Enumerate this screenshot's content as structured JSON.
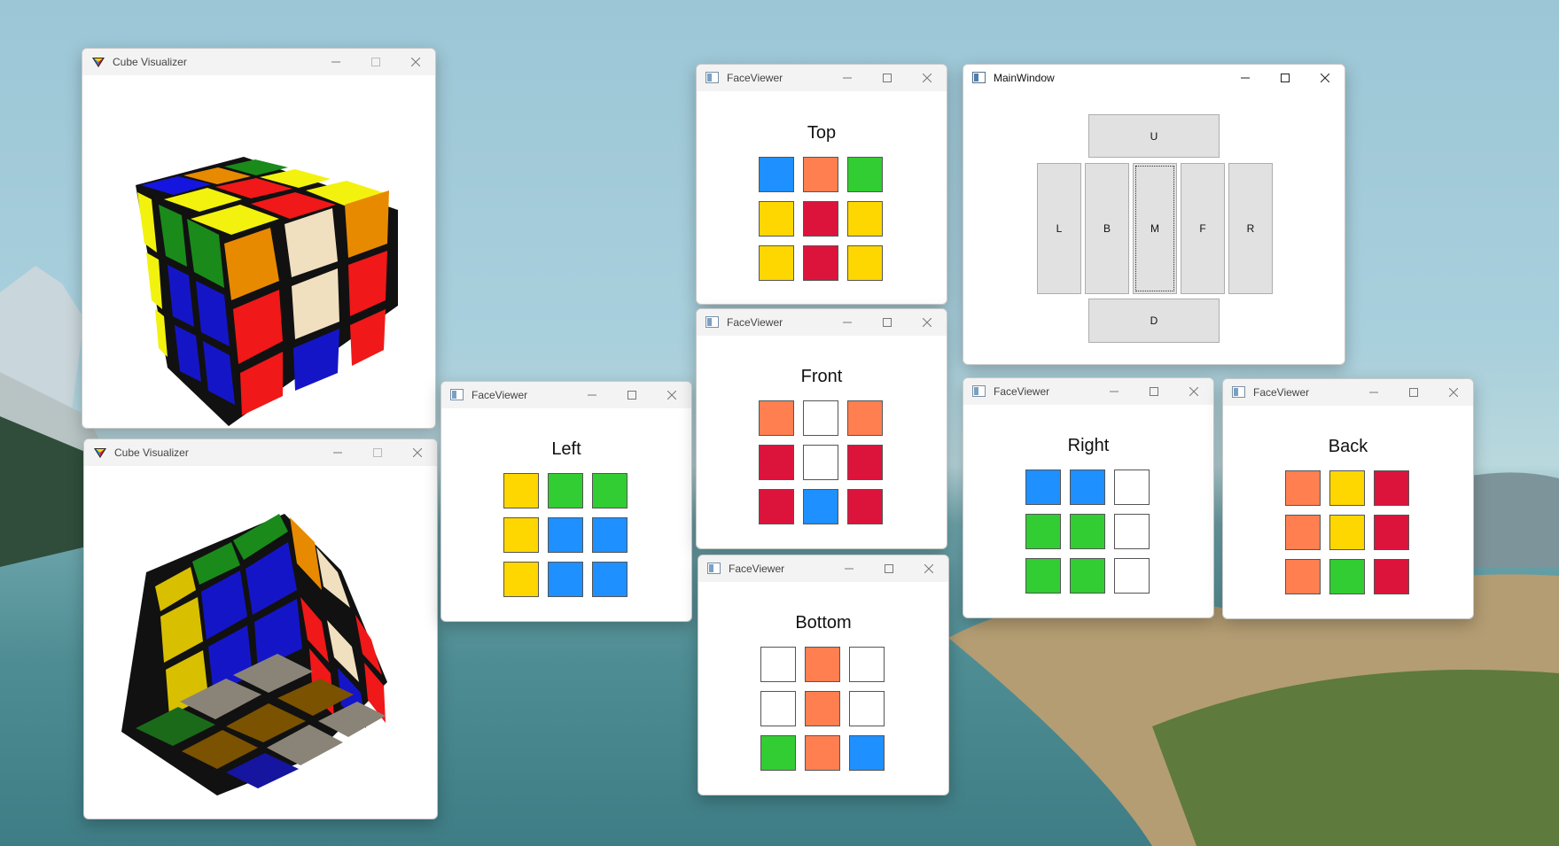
{
  "colors": {
    "blue": "#1E90FF",
    "orange": "#FF7F50",
    "green": "#32CD32",
    "yellow": "#FFD700",
    "red": "#DC143C",
    "white": "#FFFFFF"
  },
  "cube_windows": [
    {
      "title": "Cube Visualizer"
    },
    {
      "title": "Cube Visualizer"
    }
  ],
  "faces": {
    "top": {
      "window_title": "FaceViewer",
      "label": "Top",
      "stickers": [
        "blue",
        "orange",
        "green",
        "yellow",
        "red",
        "yellow",
        "yellow",
        "red",
        "yellow"
      ]
    },
    "front": {
      "window_title": "FaceViewer",
      "label": "Front",
      "stickers": [
        "orange",
        "white",
        "orange",
        "red",
        "white",
        "red",
        "red",
        "blue",
        "red"
      ]
    },
    "bottom": {
      "window_title": "FaceViewer",
      "label": "Bottom",
      "stickers": [
        "white",
        "orange",
        "white",
        "white",
        "orange",
        "white",
        "green",
        "orange",
        "blue"
      ]
    },
    "left": {
      "window_title": "FaceViewer",
      "label": "Left",
      "stickers": [
        "yellow",
        "green",
        "green",
        "yellow",
        "blue",
        "blue",
        "yellow",
        "blue",
        "blue"
      ]
    },
    "right": {
      "window_title": "FaceViewer",
      "label": "Right",
      "stickers": [
        "blue",
        "blue",
        "white",
        "green",
        "green",
        "white",
        "green",
        "green",
        "white"
      ]
    },
    "back": {
      "window_title": "FaceViewer",
      "label": "Back",
      "stickers": [
        "orange",
        "yellow",
        "red",
        "orange",
        "yellow",
        "red",
        "orange",
        "green",
        "red"
      ]
    }
  },
  "main_window": {
    "title": "MainWindow",
    "buttons": {
      "u": "U",
      "l": "L",
      "b": "B",
      "m": "M",
      "f": "F",
      "r": "R",
      "d": "D"
    }
  }
}
